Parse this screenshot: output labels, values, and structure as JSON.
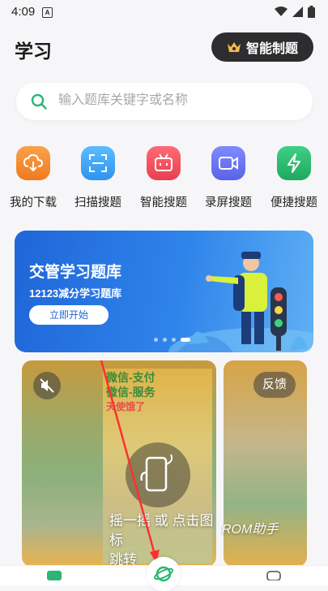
{
  "status_bar": {
    "time": "4:09",
    "sim_letter": "A"
  },
  "header": {
    "title": "学习",
    "ai_button_label": "智能制题"
  },
  "search": {
    "placeholder": "输入题库关键字或名称"
  },
  "shortcuts": [
    {
      "label": "我的下载",
      "icon": "cloud-download-icon",
      "color": "#f5882b"
    },
    {
      "label": "扫描搜题",
      "icon": "scan-icon",
      "color": "#3aa3f5"
    },
    {
      "label": "智能搜题",
      "icon": "tv-bot-icon",
      "color": "#ef4e5a"
    },
    {
      "label": "录屏搜题",
      "icon": "video-record-icon",
      "color": "#6672f0"
    },
    {
      "label": "便捷搜题",
      "icon": "lightning-icon",
      "color": "#25b36a"
    }
  ],
  "banner": {
    "title": "交管学习题库",
    "subtitle": "12123减分学习题库",
    "cta": "立即开始"
  },
  "feed": {
    "ad_text_line1": "微信-支付",
    "ad_text_line2": "微信-服务",
    "ad_text_line3": "天使饿了",
    "gesture_text": "摇一摇 或 点击图标",
    "gesture_text2": "跳转",
    "rom_text": "ROM助手",
    "feedback_label": "反馈"
  },
  "colors": {
    "accent_dark": "#2d2d2f",
    "banner_blue": "#1f66d9",
    "search_icon": "#2bb673"
  }
}
